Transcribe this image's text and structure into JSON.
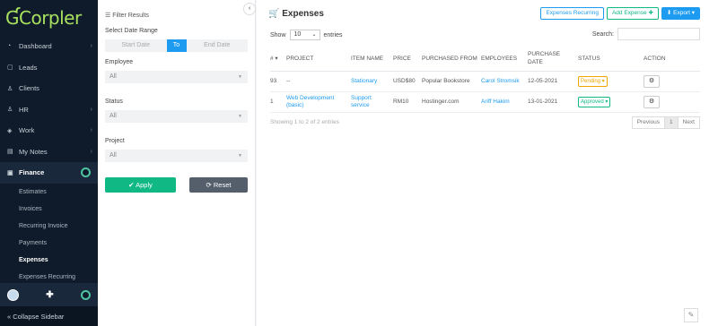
{
  "brand": {
    "logo": "Corpler"
  },
  "sidebar": {
    "items": [
      {
        "label": "Dashboard",
        "icon": "dashboard-icon",
        "glyph": "◔",
        "chevron": true
      },
      {
        "label": "Leads",
        "icon": "leads-icon",
        "glyph": "▢",
        "chevron": false
      },
      {
        "label": "Clients",
        "icon": "clients-icon",
        "glyph": "♙",
        "chevron": false
      },
      {
        "label": "HR",
        "icon": "hr-icon",
        "glyph": "♙",
        "chevron": true
      },
      {
        "label": "Work",
        "icon": "work-icon",
        "glyph": "◈",
        "chevron": true
      },
      {
        "label": "My Notes",
        "icon": "notes-icon",
        "glyph": "▤",
        "chevron": true
      },
      {
        "label": "Finance",
        "icon": "finance-icon",
        "glyph": "▣",
        "chevron": false,
        "active": true
      }
    ],
    "finance_sub": [
      "Estimates",
      "Invoices",
      "Recurring Invoice",
      "Payments",
      "Expenses",
      "Expenses Recurring"
    ],
    "active_sub": "Expenses",
    "collapse_label": "« Collapse Sidebar"
  },
  "filter": {
    "title": "☰ Filter Results",
    "date_label": "Select Date Range",
    "start_placeholder": "Start Date",
    "to_label": "To",
    "end_placeholder": "End Date",
    "employee_label": "Employee",
    "employee_value": "All",
    "status_label": "Status",
    "status_value": "All",
    "project_label": "Project",
    "project_value": "All",
    "apply_label": "✔ Apply",
    "reset_label": "⟳ Reset"
  },
  "main": {
    "title": "🛒 Expenses",
    "btn_recurring": "Expenses Recurring",
    "btn_add": "Add Expense ✚",
    "btn_export": "⬇ Export ▾",
    "show_label": "Show",
    "show_value": "10",
    "entries_label": "entries",
    "search_label": "Search:",
    "columns": [
      "# ▾",
      "PROJECT",
      "ITEM NAME",
      "PRICE",
      "PURCHASED FROM",
      "EMPLOYEES",
      "PURCHASE DATE",
      "STATUS",
      "ACTION"
    ],
    "rows": [
      {
        "id": "93",
        "project": "--",
        "item": "Stationary",
        "price": "USD$80",
        "from": "Popular Bookstore",
        "employee": "Carol Stromsik",
        "date": "12-05-2021",
        "status": "Pending ▾",
        "status_type": "pend"
      },
      {
        "id": "1",
        "project": "Web Development (basic)",
        "item": "Support service",
        "price": "RM10",
        "from": "Hostinger.com",
        "employee": "Ariff Hakim",
        "date": "13-01-2021",
        "status": "Approved ▾",
        "status_type": "appr"
      }
    ],
    "info": "Showing 1 to 2 of 2 entries",
    "pager": [
      "Previous",
      "1",
      "Next"
    ]
  }
}
